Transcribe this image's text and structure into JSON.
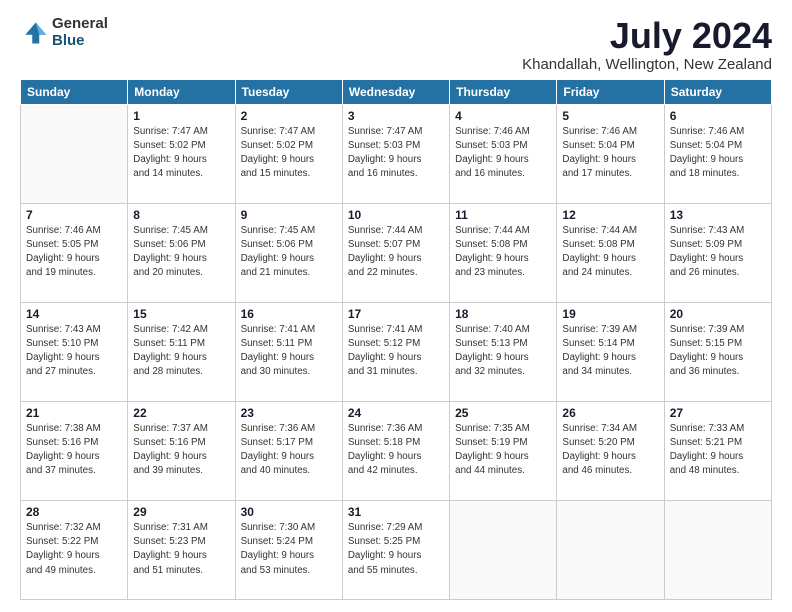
{
  "logo": {
    "general": "General",
    "blue": "Blue"
  },
  "title": "July 2024",
  "subtitle": "Khandallah, Wellington, New Zealand",
  "days_of_week": [
    "Sunday",
    "Monday",
    "Tuesday",
    "Wednesday",
    "Thursday",
    "Friday",
    "Saturday"
  ],
  "weeks": [
    [
      {
        "day": "",
        "info": ""
      },
      {
        "day": "1",
        "info": "Sunrise: 7:47 AM\nSunset: 5:02 PM\nDaylight: 9 hours\nand 14 minutes."
      },
      {
        "day": "2",
        "info": "Sunrise: 7:47 AM\nSunset: 5:02 PM\nDaylight: 9 hours\nand 15 minutes."
      },
      {
        "day": "3",
        "info": "Sunrise: 7:47 AM\nSunset: 5:03 PM\nDaylight: 9 hours\nand 16 minutes."
      },
      {
        "day": "4",
        "info": "Sunrise: 7:46 AM\nSunset: 5:03 PM\nDaylight: 9 hours\nand 16 minutes."
      },
      {
        "day": "5",
        "info": "Sunrise: 7:46 AM\nSunset: 5:04 PM\nDaylight: 9 hours\nand 17 minutes."
      },
      {
        "day": "6",
        "info": "Sunrise: 7:46 AM\nSunset: 5:04 PM\nDaylight: 9 hours\nand 18 minutes."
      }
    ],
    [
      {
        "day": "7",
        "info": "Sunrise: 7:46 AM\nSunset: 5:05 PM\nDaylight: 9 hours\nand 19 minutes."
      },
      {
        "day": "8",
        "info": "Sunrise: 7:45 AM\nSunset: 5:06 PM\nDaylight: 9 hours\nand 20 minutes."
      },
      {
        "day": "9",
        "info": "Sunrise: 7:45 AM\nSunset: 5:06 PM\nDaylight: 9 hours\nand 21 minutes."
      },
      {
        "day": "10",
        "info": "Sunrise: 7:44 AM\nSunset: 5:07 PM\nDaylight: 9 hours\nand 22 minutes."
      },
      {
        "day": "11",
        "info": "Sunrise: 7:44 AM\nSunset: 5:08 PM\nDaylight: 9 hours\nand 23 minutes."
      },
      {
        "day": "12",
        "info": "Sunrise: 7:44 AM\nSunset: 5:08 PM\nDaylight: 9 hours\nand 24 minutes."
      },
      {
        "day": "13",
        "info": "Sunrise: 7:43 AM\nSunset: 5:09 PM\nDaylight: 9 hours\nand 26 minutes."
      }
    ],
    [
      {
        "day": "14",
        "info": "Sunrise: 7:43 AM\nSunset: 5:10 PM\nDaylight: 9 hours\nand 27 minutes."
      },
      {
        "day": "15",
        "info": "Sunrise: 7:42 AM\nSunset: 5:11 PM\nDaylight: 9 hours\nand 28 minutes."
      },
      {
        "day": "16",
        "info": "Sunrise: 7:41 AM\nSunset: 5:11 PM\nDaylight: 9 hours\nand 30 minutes."
      },
      {
        "day": "17",
        "info": "Sunrise: 7:41 AM\nSunset: 5:12 PM\nDaylight: 9 hours\nand 31 minutes."
      },
      {
        "day": "18",
        "info": "Sunrise: 7:40 AM\nSunset: 5:13 PM\nDaylight: 9 hours\nand 32 minutes."
      },
      {
        "day": "19",
        "info": "Sunrise: 7:39 AM\nSunset: 5:14 PM\nDaylight: 9 hours\nand 34 minutes."
      },
      {
        "day": "20",
        "info": "Sunrise: 7:39 AM\nSunset: 5:15 PM\nDaylight: 9 hours\nand 36 minutes."
      }
    ],
    [
      {
        "day": "21",
        "info": "Sunrise: 7:38 AM\nSunset: 5:16 PM\nDaylight: 9 hours\nand 37 minutes."
      },
      {
        "day": "22",
        "info": "Sunrise: 7:37 AM\nSunset: 5:16 PM\nDaylight: 9 hours\nand 39 minutes."
      },
      {
        "day": "23",
        "info": "Sunrise: 7:36 AM\nSunset: 5:17 PM\nDaylight: 9 hours\nand 40 minutes."
      },
      {
        "day": "24",
        "info": "Sunrise: 7:36 AM\nSunset: 5:18 PM\nDaylight: 9 hours\nand 42 minutes."
      },
      {
        "day": "25",
        "info": "Sunrise: 7:35 AM\nSunset: 5:19 PM\nDaylight: 9 hours\nand 44 minutes."
      },
      {
        "day": "26",
        "info": "Sunrise: 7:34 AM\nSunset: 5:20 PM\nDaylight: 9 hours\nand 46 minutes."
      },
      {
        "day": "27",
        "info": "Sunrise: 7:33 AM\nSunset: 5:21 PM\nDaylight: 9 hours\nand 48 minutes."
      }
    ],
    [
      {
        "day": "28",
        "info": "Sunrise: 7:32 AM\nSunset: 5:22 PM\nDaylight: 9 hours\nand 49 minutes."
      },
      {
        "day": "29",
        "info": "Sunrise: 7:31 AM\nSunset: 5:23 PM\nDaylight: 9 hours\nand 51 minutes."
      },
      {
        "day": "30",
        "info": "Sunrise: 7:30 AM\nSunset: 5:24 PM\nDaylight: 9 hours\nand 53 minutes."
      },
      {
        "day": "31",
        "info": "Sunrise: 7:29 AM\nSunset: 5:25 PM\nDaylight: 9 hours\nand 55 minutes."
      },
      {
        "day": "",
        "info": ""
      },
      {
        "day": "",
        "info": ""
      },
      {
        "day": "",
        "info": ""
      }
    ]
  ]
}
